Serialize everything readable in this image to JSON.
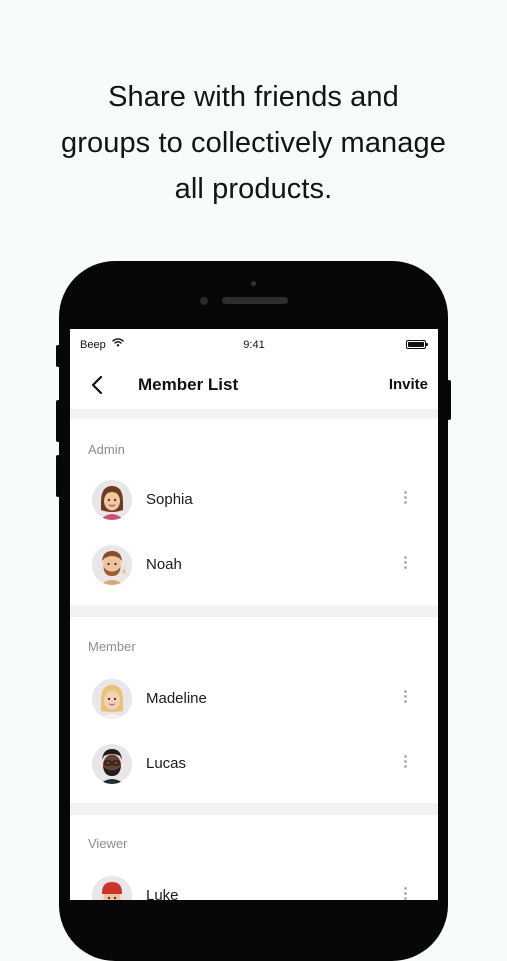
{
  "headline": {
    "line1": "Share with friends and",
    "line2": "groups to collectively manage",
    "line3": "all products."
  },
  "status_bar": {
    "carrier": "Beep",
    "time": "9:41",
    "wifi_icon": "wifi-icon",
    "battery_icon": "battery-icon"
  },
  "nav": {
    "back_icon": "chevron-left-icon",
    "title": "Member List",
    "invite_label": "Invite"
  },
  "sections": [
    {
      "label": "Admin",
      "members": [
        {
          "name": "Sophia",
          "avatar": "memoji-sophia"
        },
        {
          "name": "Noah",
          "avatar": "memoji-noah"
        }
      ]
    },
    {
      "label": "Member",
      "members": [
        {
          "name": "Madeline",
          "avatar": "memoji-madeline"
        },
        {
          "name": "Lucas",
          "avatar": "memoji-lucas"
        }
      ]
    },
    {
      "label": "Viewer",
      "members": [
        {
          "name": "Luke",
          "avatar": "memoji-luke"
        }
      ]
    }
  ],
  "colors": {
    "page_background": "#f6fbfb",
    "phone_frame": "#070707",
    "screen_background": "#f1f2f3",
    "section_label": "#8e8e8e"
  }
}
